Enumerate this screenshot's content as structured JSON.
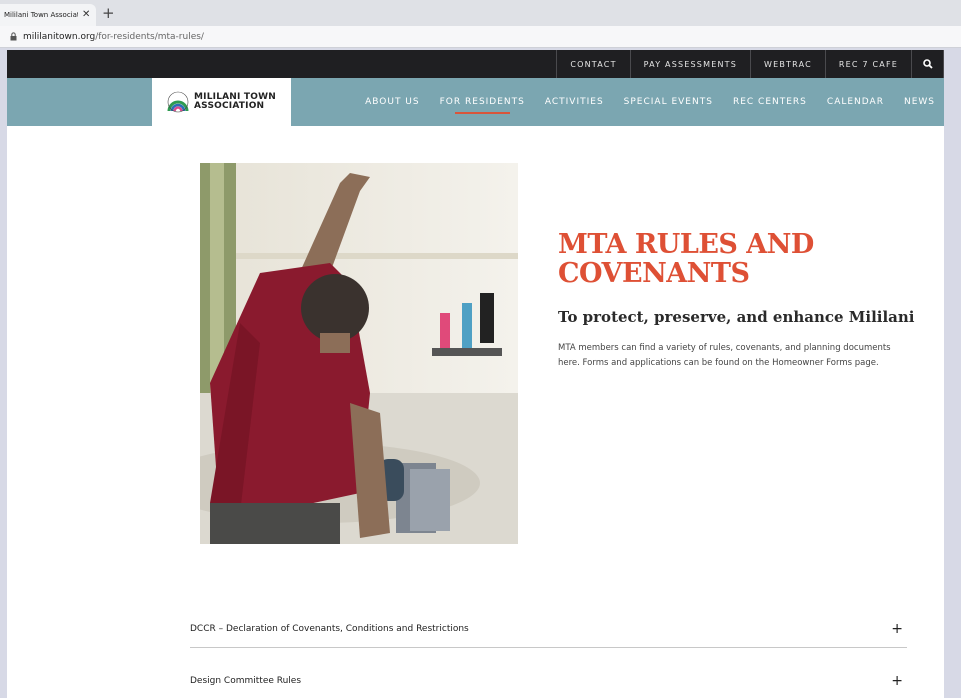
{
  "browser": {
    "tab_title": "Mililani Town Associati",
    "tab_close": "✕",
    "new_tab": "+",
    "url_host": "mililanitown.org",
    "url_path": "/for-residents/mta-rules/"
  },
  "topbar": {
    "items": [
      "CONTACT",
      "PAY ASSESSMENTS",
      "WEBTRAC",
      "REC 7 CAFE"
    ],
    "search_icon": "search-icon"
  },
  "logo": {
    "line1": "MILILANI TOWN",
    "line2": "ASSOCIATION"
  },
  "nav": {
    "items": [
      "ABOUT US",
      "FOR RESIDENTS",
      "ACTIVITIES",
      "SPECIAL EVENTS",
      "REC CENTERS",
      "CALENDAR",
      "NEWS"
    ],
    "active": "FOR RESIDENTS"
  },
  "hero": {
    "title_line1": "MTA RULES AND",
    "title_line2": "COVENANTS",
    "subtitle": "To protect, preserve, and enhance Mililani",
    "body": "MTA members can find a variety of rules, covenants, and planning documents here. Forms and applications can be found on the Homeowner Forms page."
  },
  "accordion": {
    "items": [
      "DCCR – Declaration of Covenants, Conditions and Restrictions",
      "Design Committee Rules"
    ],
    "expand_symbol": "+"
  },
  "colors": {
    "accent": "#de5035",
    "nav_bg": "#7ba6b1",
    "topbar_bg": "#1f1f22"
  }
}
